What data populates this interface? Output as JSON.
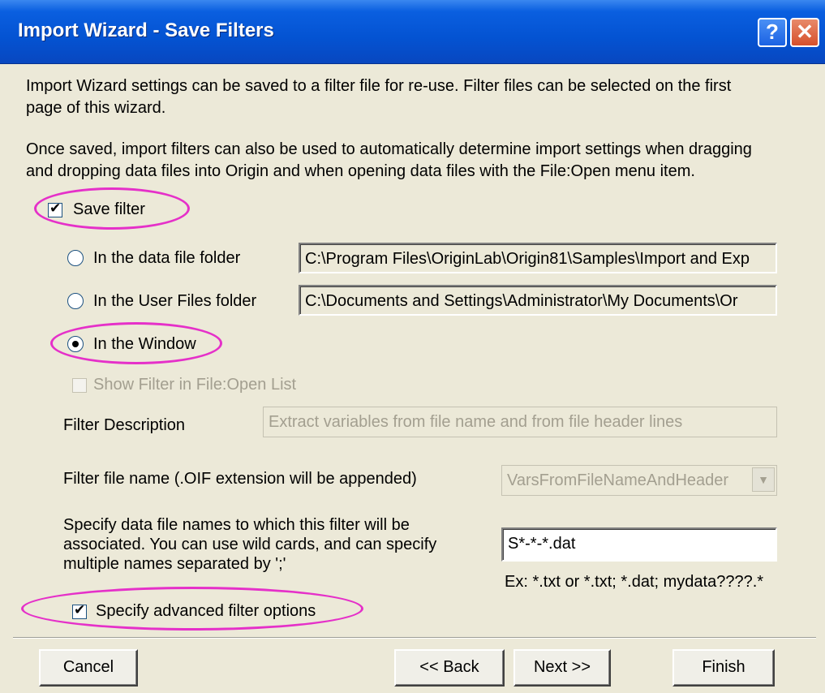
{
  "window": {
    "title": "Import Wizard - Save Filters",
    "help_glyph": "?",
    "close_glyph": "✕"
  },
  "intro": {
    "para1_line1": "Import Wizard settings can be saved to a filter file for re-use. Filter files can be selected on the first",
    "para1_line2": "page of this wizard.",
    "para2_line1": "Once saved, import filters can also be used to automatically determine import settings when dragging",
    "para2_line2": "and dropping data files into Origin and when opening data files with the File:Open menu item."
  },
  "save_filter": {
    "label": "Save filter",
    "checked": true
  },
  "locations": [
    {
      "label": "In the data file folder",
      "path": "C:\\Program Files\\OriginLab\\Origin81\\Samples\\Import and Exp",
      "selected": false
    },
    {
      "label": "In the User Files folder",
      "path": "C:\\Documents and Settings\\Administrator\\My Documents\\Or",
      "selected": false
    },
    {
      "label": "In the Window",
      "selected": true
    }
  ],
  "show_filter": {
    "label": "Show Filter in File:Open List",
    "checked": false,
    "enabled": false
  },
  "description": {
    "label": "Filter Description",
    "value": "Extract variables from file name and from file header lines"
  },
  "filename": {
    "label": "Filter file name (.OIF extension will be appended)",
    "value": "VarsFromFileNameAndHeader",
    "arrow": "▼"
  },
  "associate": {
    "line1": "Specify data file names to which this filter will be",
    "line2": "associated.  You can use wild cards, and can specify",
    "line3": "multiple names separated by ';'",
    "value": "S*-*-*.dat",
    "example": "Ex: *.txt or *.txt; *.dat; mydata????.*"
  },
  "advanced": {
    "label": "Specify advanced filter options",
    "checked": true
  },
  "buttons": {
    "cancel": "Cancel",
    "back": "<< Back",
    "next": "Next >>",
    "finish": "Finish"
  },
  "highlight_color": "#e530c9"
}
